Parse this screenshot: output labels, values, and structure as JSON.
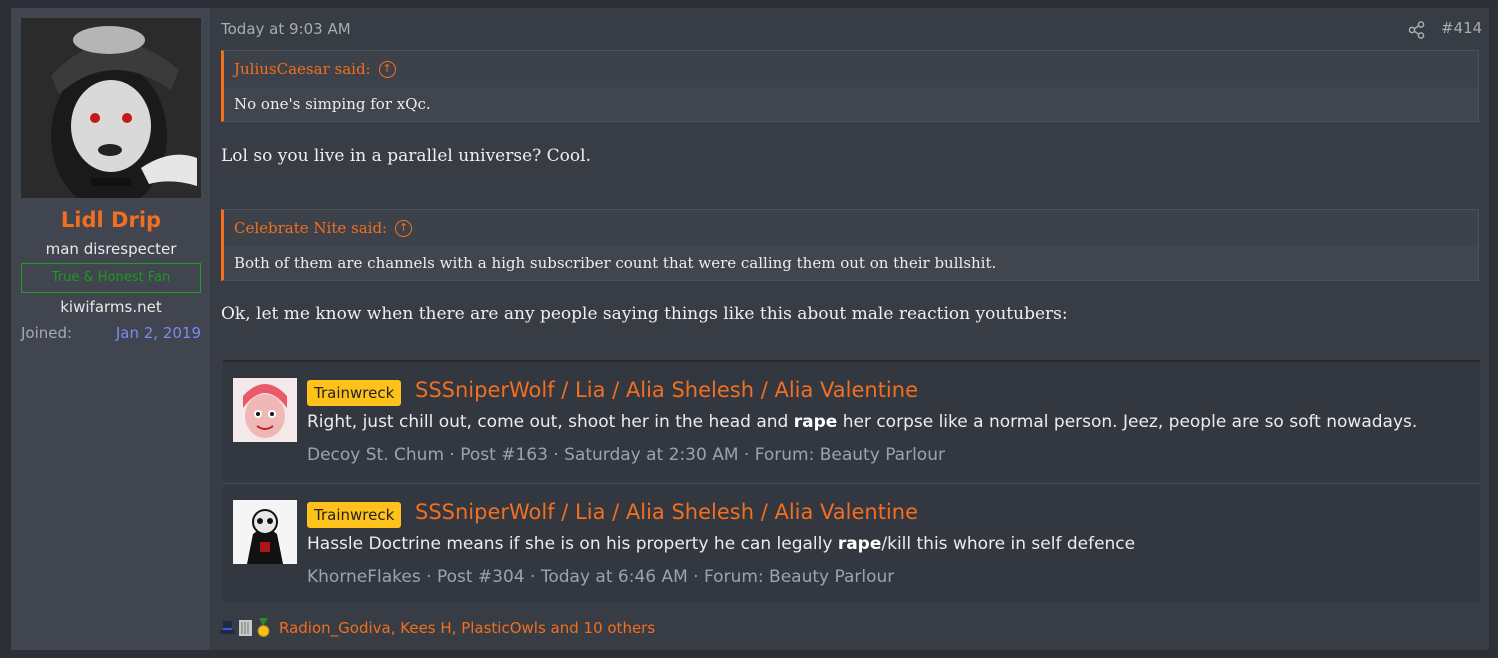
{
  "user": {
    "name": "Lidl Drip",
    "title": "man disrespecter",
    "banner": "True & Honest Fan",
    "extra": "kiwifarms.net",
    "joined_label": "Joined:",
    "joined_value": "Jan 2, 2019"
  },
  "post": {
    "date": "Today at 9:03 AM",
    "number": "#414",
    "quote1": {
      "author": "JuliusCaesar said:",
      "text": "No one's simping for xQc."
    },
    "reply1": "Lol so you live in a parallel universe? Cool.",
    "quote2": {
      "author": "Celebrate Nite said:",
      "text": "Both of them are channels with a high subscriber count that were calling them out on their bullshit."
    },
    "reply2": "Ok, let me know when there are any people saying things like this about male reaction youtubers:"
  },
  "results": [
    {
      "prefix": "Trainwreck",
      "title": "SSSniperWolf / Lia / Alia Shelesh / Alia Valentine",
      "snippet_a": "Right, just chill out, come out, shoot her in the head and ",
      "snippet_bold": "rape",
      "snippet_b": " her corpse like a normal person. Jeez, people are so soft nowadays.",
      "author": "Decoy St. Chum",
      "post": "Post #163",
      "time": "Saturday at 2:30 AM",
      "forum": "Forum: Beauty Parlour"
    },
    {
      "prefix": "Trainwreck",
      "title": "SSSniperWolf / Lia / Alia Shelesh / Alia Valentine",
      "snippet_a": "Hassle Doctrine means if she is on his property he can legally ",
      "snippet_bold": "rape",
      "snippet_b": "/kill this whore in self defence",
      "author": "KhorneFlakes",
      "post": "Post #304",
      "time": "Today at 6:46 AM",
      "forum": "Forum: Beauty Parlour"
    }
  ],
  "meta_sep": " · ",
  "reactions": {
    "icons": [
      "top-hat-icon",
      "book-icon",
      "medal-icon"
    ],
    "text": "Radion_Godiva, Kees H, PlasticOwls and 10 others"
  },
  "colors": {
    "accent": "#f26f1f",
    "prefix": "#ffc21a",
    "banner": "#1aa01a",
    "joined": "#7b8bf0"
  }
}
